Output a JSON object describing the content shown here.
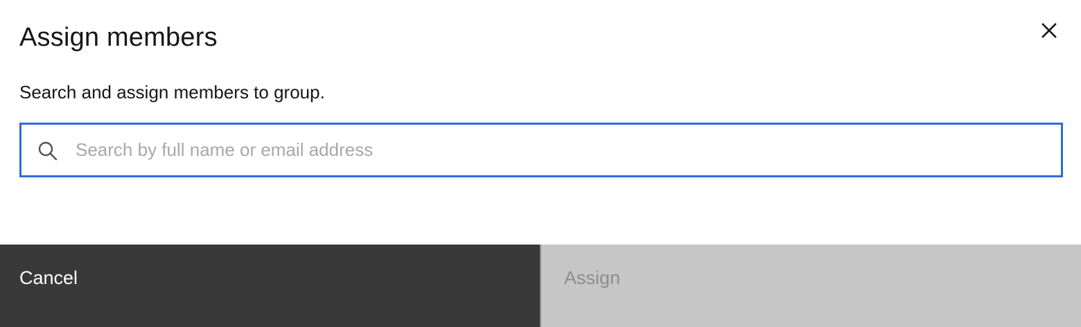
{
  "modal": {
    "title": "Assign members",
    "subtitle": "Search and assign members to group.",
    "close_icon": "close-icon"
  },
  "search": {
    "placeholder": "Search by full name or email address",
    "value": "",
    "icon": "search-icon",
    "focus_color": "#3168e0"
  },
  "footer": {
    "cancel_label": "Cancel",
    "assign_label": "Assign",
    "assign_disabled": true
  }
}
